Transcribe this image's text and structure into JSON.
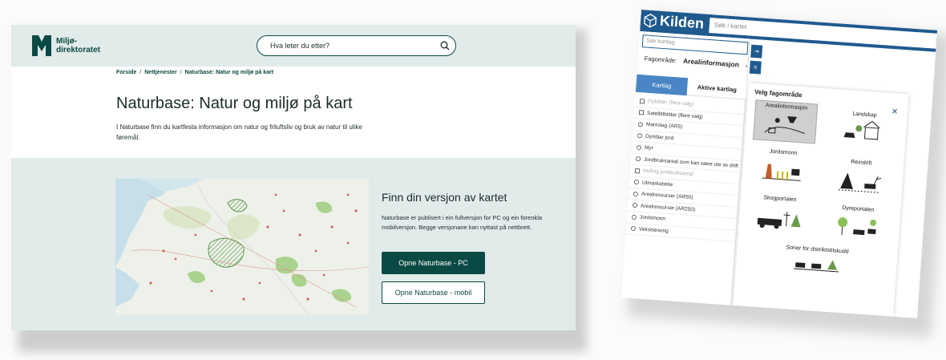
{
  "left": {
    "logo": {
      "line1": "Miljø-",
      "line2": "direktoratet"
    },
    "search": {
      "placeholder": "Hva leter du etter?"
    },
    "breadcrumb": [
      "Forside",
      "Nettjenester",
      "Naturbase: Natur og miljø på kart"
    ],
    "breadcrumb_sep": "/",
    "title": "Naturbase: Natur og miljø på kart",
    "intro": "I Naturbase finn du kartfesta informasjon om natur og friluftsliv og bruk av natur til ulike føremål.",
    "cta": {
      "title": "Finn din versjon av kartet",
      "text": "Naturbase er publisert i ein fullversjon for PC og ein forenkla mobilversjon. Begge versjonane kan nyttast på nettbrett.",
      "button_pc": "Opne Naturbase - PC",
      "button_mobil": "Opne Naturbase - mobil"
    },
    "colors": {
      "brand": "#0b4a44",
      "band": "#e1ebea"
    }
  },
  "right": {
    "app_title": "Kilden",
    "search_placeholder": "Søk i kartet",
    "layer_search_placeholder": "Søk kartlag",
    "fagomrade_label": "Fagområde:",
    "fagomrade_value": "Arealinformasjon",
    "tabs": [
      "Kartlag",
      "Aktive kartlag"
    ],
    "layers": [
      {
        "label": "Flybilder (flere valg)",
        "kind": "checkbox",
        "dim": true
      },
      {
        "label": "Satellittbilder (flere valg)",
        "kind": "checkbox",
        "dim": false
      },
      {
        "label": "Markslag (AR5)",
        "kind": "group",
        "dim": false
      },
      {
        "label": "Dyrkbar jord",
        "kind": "group",
        "dim": false
      },
      {
        "label": "Myr",
        "kind": "group",
        "dim": false
      },
      {
        "label": "Jordbruksareal som kan være ute av drift",
        "kind": "group",
        "dim": false
      },
      {
        "label": "Helling jordbruksareal",
        "kind": "checkbox",
        "dim": true
      },
      {
        "label": "Utmarksbeite",
        "kind": "group",
        "dim": false
      },
      {
        "label": "Arealressurser (AR50)",
        "kind": "group",
        "dim": false
      },
      {
        "label": "Arealressurser (AR250)",
        "kind": "group",
        "dim": false
      },
      {
        "label": "Jordsmonn",
        "kind": "group",
        "dim": false
      },
      {
        "label": "Vekstsesong",
        "kind": "group",
        "dim": false
      }
    ],
    "popup": {
      "title": "Velg fagområde",
      "tiles": [
        "Arealinformasjon",
        "Landskap",
        "Jordsmonn",
        "Reindrift",
        "Skogportalen",
        "Dyreportalen",
        "Soner for distriktstilskudd"
      ]
    },
    "colors": {
      "brand": "#1f5a8e",
      "tab": "#4a86c5"
    }
  }
}
